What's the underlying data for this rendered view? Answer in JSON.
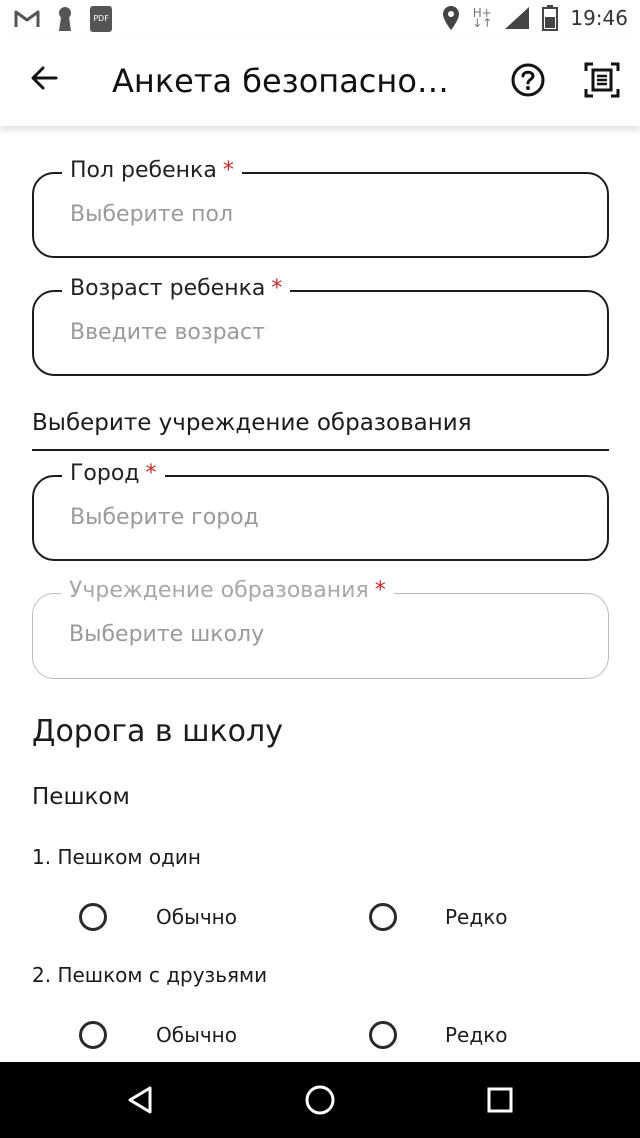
{
  "status_bar": {
    "left_icons": [
      "gmail-icon",
      "keyhole-icon",
      "pdf-icon"
    ],
    "pdf_label": "PDF",
    "network_type": "H+",
    "time": "19:46"
  },
  "app_bar": {
    "title": "Анкета безопасно…",
    "back_icon": "back-arrow-icon",
    "help_icon": "help-circle-icon",
    "scan_icon": "document-scan-icon"
  },
  "form": {
    "gender": {
      "label": "Пол ребенка",
      "required_mark": "*",
      "placeholder": "Выберите пол"
    },
    "age": {
      "label": "Возраст ребенка",
      "required_mark": "*",
      "placeholder": "Введите возраст"
    },
    "school_section_label": "Выберите учреждение образования",
    "city": {
      "label": "Город",
      "required_mark": "*",
      "placeholder": "Выберите город"
    },
    "institution": {
      "label": "Учреждение образования",
      "required_mark": "*",
      "placeholder": "Выберите школу",
      "disabled": true
    }
  },
  "road_section": {
    "heading": "Дорога в школу",
    "subheading": "Пешком",
    "questions": [
      {
        "text": "1. Пешком один",
        "options": [
          "Обычно",
          "Редко"
        ]
      },
      {
        "text": "2. Пешком с друзьями",
        "options": [
          "Обычно",
          "Редко"
        ]
      }
    ]
  },
  "nav_bar": {
    "icons": [
      "nav-back-icon",
      "nav-home-icon",
      "nav-recents-icon"
    ]
  },
  "colors": {
    "required": "#c62828",
    "placeholder": "#9a9a9a",
    "disabled_border": "#bdbdbd",
    "nav_background": "#000000"
  }
}
